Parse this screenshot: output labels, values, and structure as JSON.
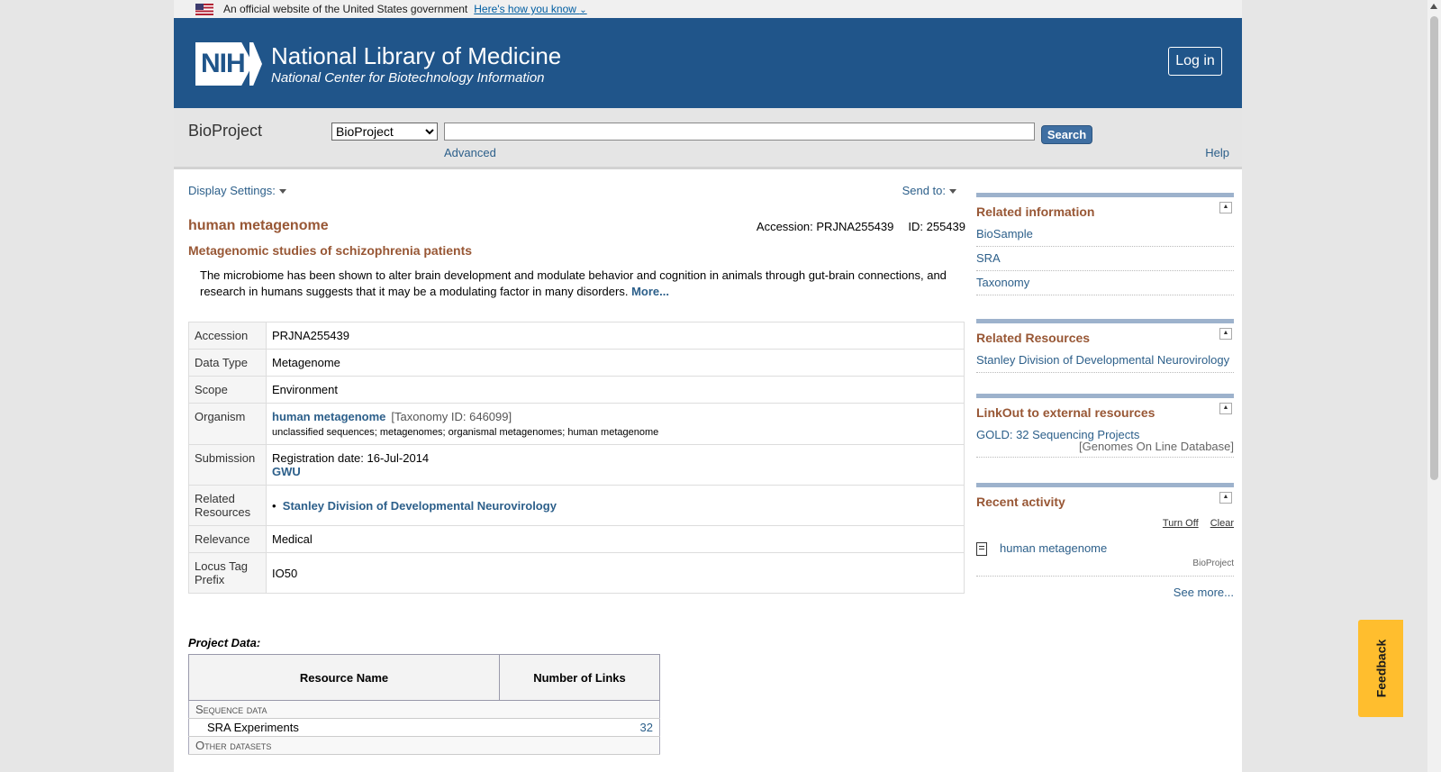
{
  "gov_banner": {
    "text": "An official website of the United States government",
    "link": "Here's how you know"
  },
  "header": {
    "logo": "NIH",
    "title": "National Library of Medicine",
    "subtitle": "National Center for Biotechnology Information",
    "login": "Log in"
  },
  "search": {
    "db_name": "BioProject",
    "selected_db": "BioProject",
    "query": "",
    "button": "Search",
    "advanced": "Advanced",
    "help": "Help"
  },
  "record": {
    "display_settings": "Display Settings:",
    "send_to": "Send to:",
    "title": "human metagenome",
    "accession_text": "Accession: PRJNA255439",
    "id_text": "ID: 255439",
    "subtitle": "Metagenomic studies of schizophrenia patients",
    "description": "The microbiome has been shown to alter brain development and modulate behavior and cognition in animals through gut-brain connections, and research in humans suggests that it may be a modulating factor in many disorders.",
    "more": "More...",
    "rows": {
      "accession": {
        "label": "Accession",
        "value": "PRJNA255439"
      },
      "data_type": {
        "label": "Data Type",
        "value": "Metagenome"
      },
      "scope": {
        "label": "Scope",
        "value": "Environment"
      },
      "organism": {
        "label": "Organism",
        "name": "human metagenome",
        "taxid": "[Taxonomy ID: 646099]",
        "lineage": "unclassified sequences; metagenomes; organismal metagenomes; human metagenome"
      },
      "submission": {
        "label": "Submission",
        "date": "Registration date: 16-Jul-2014",
        "org": "GWU"
      },
      "related": {
        "label": "Related Resources",
        "item": "Stanley Division of Developmental Neurovirology"
      },
      "relevance": {
        "label": "Relevance",
        "value": "Medical"
      },
      "locus": {
        "label": "Locus Tag Prefix",
        "value": "IO50"
      }
    }
  },
  "project_data": {
    "title": "Project Data:",
    "col1": "Resource Name",
    "col2": "Number of Links",
    "group1": "Sequence data",
    "row1_name": "SRA Experiments",
    "row1_count": "32",
    "group2": "Other datasets"
  },
  "side": {
    "related_info": {
      "title": "Related information",
      "links": [
        "BioSample",
        "SRA",
        "Taxonomy"
      ]
    },
    "related_resources": {
      "title": "Related Resources",
      "link": "Stanley Division of Developmental Neurovirology"
    },
    "linkout": {
      "title": "LinkOut to external resources",
      "link": "GOLD: 32 Sequencing Projects",
      "sub": "[Genomes On Line Database]"
    },
    "recent": {
      "title": "Recent activity",
      "turn_off": "Turn Off",
      "clear": "Clear",
      "item": "human metagenome",
      "item_db": "BioProject",
      "see_more": "See more..."
    }
  },
  "feedback": "Feedback"
}
